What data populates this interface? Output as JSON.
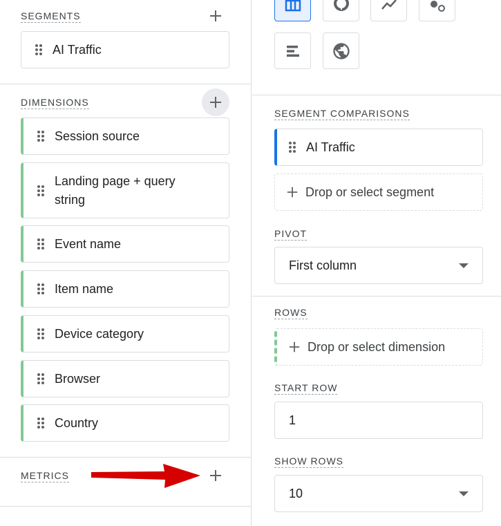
{
  "segments": {
    "label": "SEGMENTS",
    "items": [
      {
        "label": "AI Traffic"
      }
    ]
  },
  "dimensions": {
    "label": "DIMENSIONS",
    "items": [
      {
        "label": "Session source"
      },
      {
        "label": "Landing page + query string"
      },
      {
        "label": "Event name"
      },
      {
        "label": "Item name"
      },
      {
        "label": "Device category"
      },
      {
        "label": "Browser"
      },
      {
        "label": "Country"
      }
    ]
  },
  "metrics": {
    "label": "METRICS"
  },
  "segment_comparisons": {
    "label": "SEGMENT COMPARISONS",
    "items": [
      {
        "label": "AI Traffic"
      }
    ],
    "drop_label": "Drop or select segment"
  },
  "pivot": {
    "label": "PIVOT",
    "value": "First column"
  },
  "rows": {
    "label": "ROWS",
    "drop_label": "Drop or select dimension"
  },
  "start_row": {
    "label": "START ROW",
    "value": "1"
  },
  "show_rows": {
    "label": "SHOW ROWS",
    "value": "10"
  },
  "visualizations": [
    "table-icon",
    "donut-chart-icon",
    "line-chart-icon",
    "scatter-plot-icon",
    "bar-chart-icon",
    "geo-map-icon"
  ],
  "colors": {
    "accent": "#1a73e8",
    "dimension": "#81c995",
    "arrow": "#d50000"
  }
}
